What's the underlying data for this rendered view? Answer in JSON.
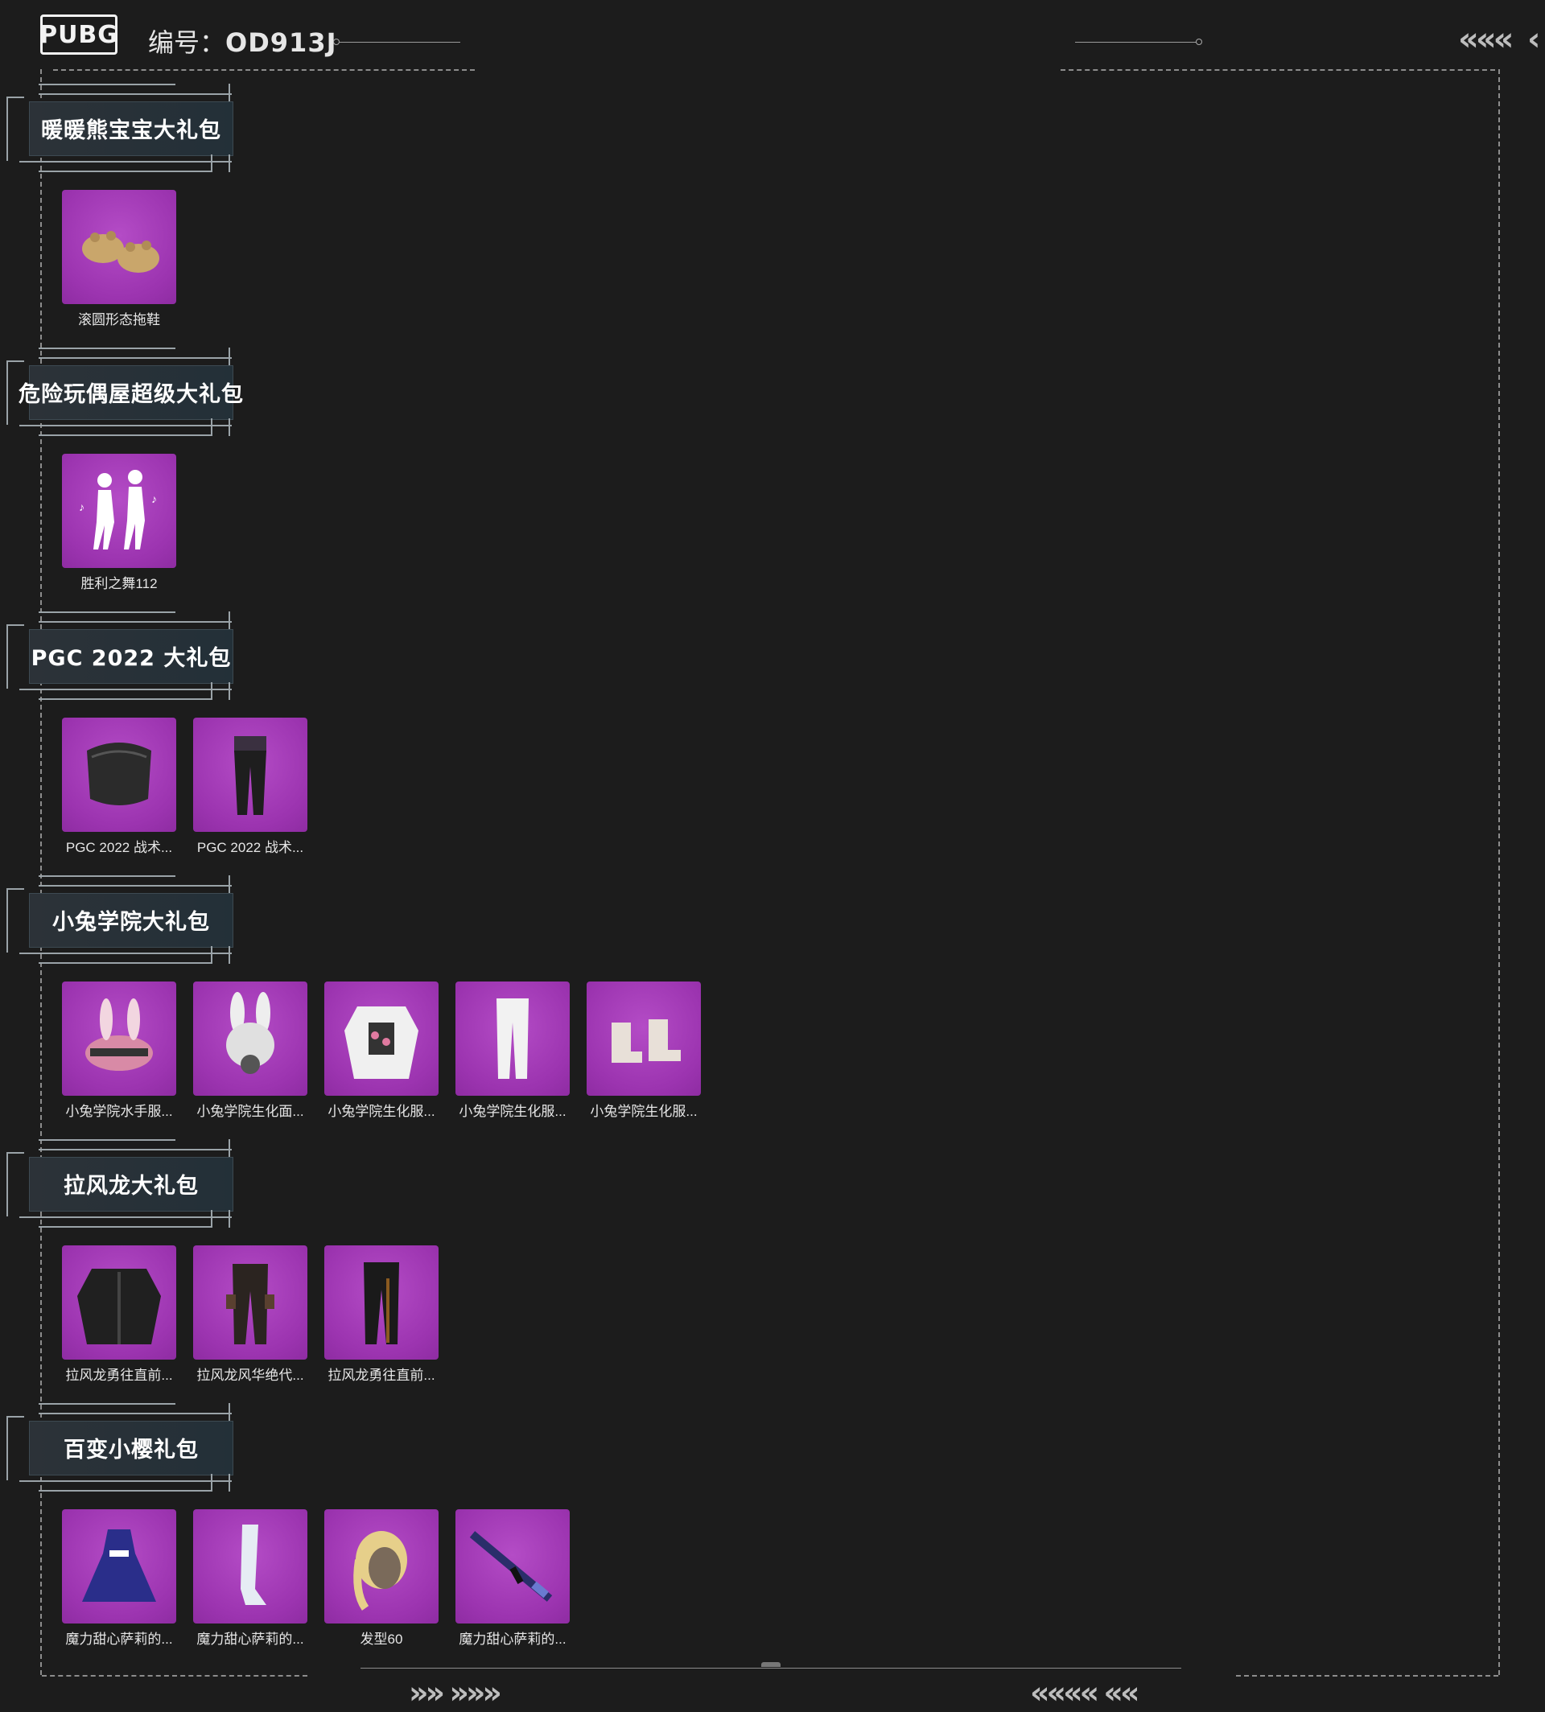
{
  "header": {
    "logo": "PUBG",
    "id_label": "编号：",
    "id_code": "OD913J"
  },
  "decor": {
    "chevrons_top_right": "«««",
    "chevrons_bottom_left": "»» »»»",
    "chevrons_bottom_right": "«««« ««"
  },
  "sections": [
    {
      "title": "暖暖熊宝宝大礼包",
      "items": [
        {
          "icon": "slippers-icon",
          "caption": "滚圆形态拖鞋"
        }
      ]
    },
    {
      "title": "危险玩偶屋超级大礼包",
      "items": [
        {
          "icon": "dance-emote-icon",
          "caption": "胜利之舞112"
        }
      ]
    },
    {
      "title": "PGC 2022 大礼包",
      "items": [
        {
          "icon": "mask-icon",
          "caption": "PGC 2022 战术..."
        },
        {
          "icon": "pants-icon",
          "caption": "PGC 2022 战术..."
        }
      ]
    },
    {
      "title": "小兔学院大礼包",
      "items": [
        {
          "icon": "bunny-helmet-icon",
          "caption": "小兔学院水手服..."
        },
        {
          "icon": "bunny-gasmask-icon",
          "caption": "小兔学院生化面..."
        },
        {
          "icon": "jacket-icon",
          "caption": "小兔学院生化服..."
        },
        {
          "icon": "white-pants-icon",
          "caption": "小兔学院生化服..."
        },
        {
          "icon": "boots-icon",
          "caption": "小兔学院生化服..."
        }
      ]
    },
    {
      "title": "拉风龙大礼包",
      "items": [
        {
          "icon": "black-jacket-icon",
          "caption": "拉风龙勇往直前..."
        },
        {
          "icon": "cargo-pants-icon",
          "caption": "拉风龙风华绝代..."
        },
        {
          "icon": "track-pants-icon",
          "caption": "拉风龙勇往直前..."
        }
      ]
    },
    {
      "title": "百变小樱礼包",
      "items": [
        {
          "icon": "dress-icon",
          "caption": "魔力甜心萨莉的..."
        },
        {
          "icon": "stocking-icon",
          "caption": "魔力甜心萨莉的..."
        },
        {
          "icon": "hairstyle-icon",
          "caption": "发型60"
        },
        {
          "icon": "rifle-icon",
          "caption": "魔力甜心萨莉的..."
        }
      ]
    }
  ]
}
